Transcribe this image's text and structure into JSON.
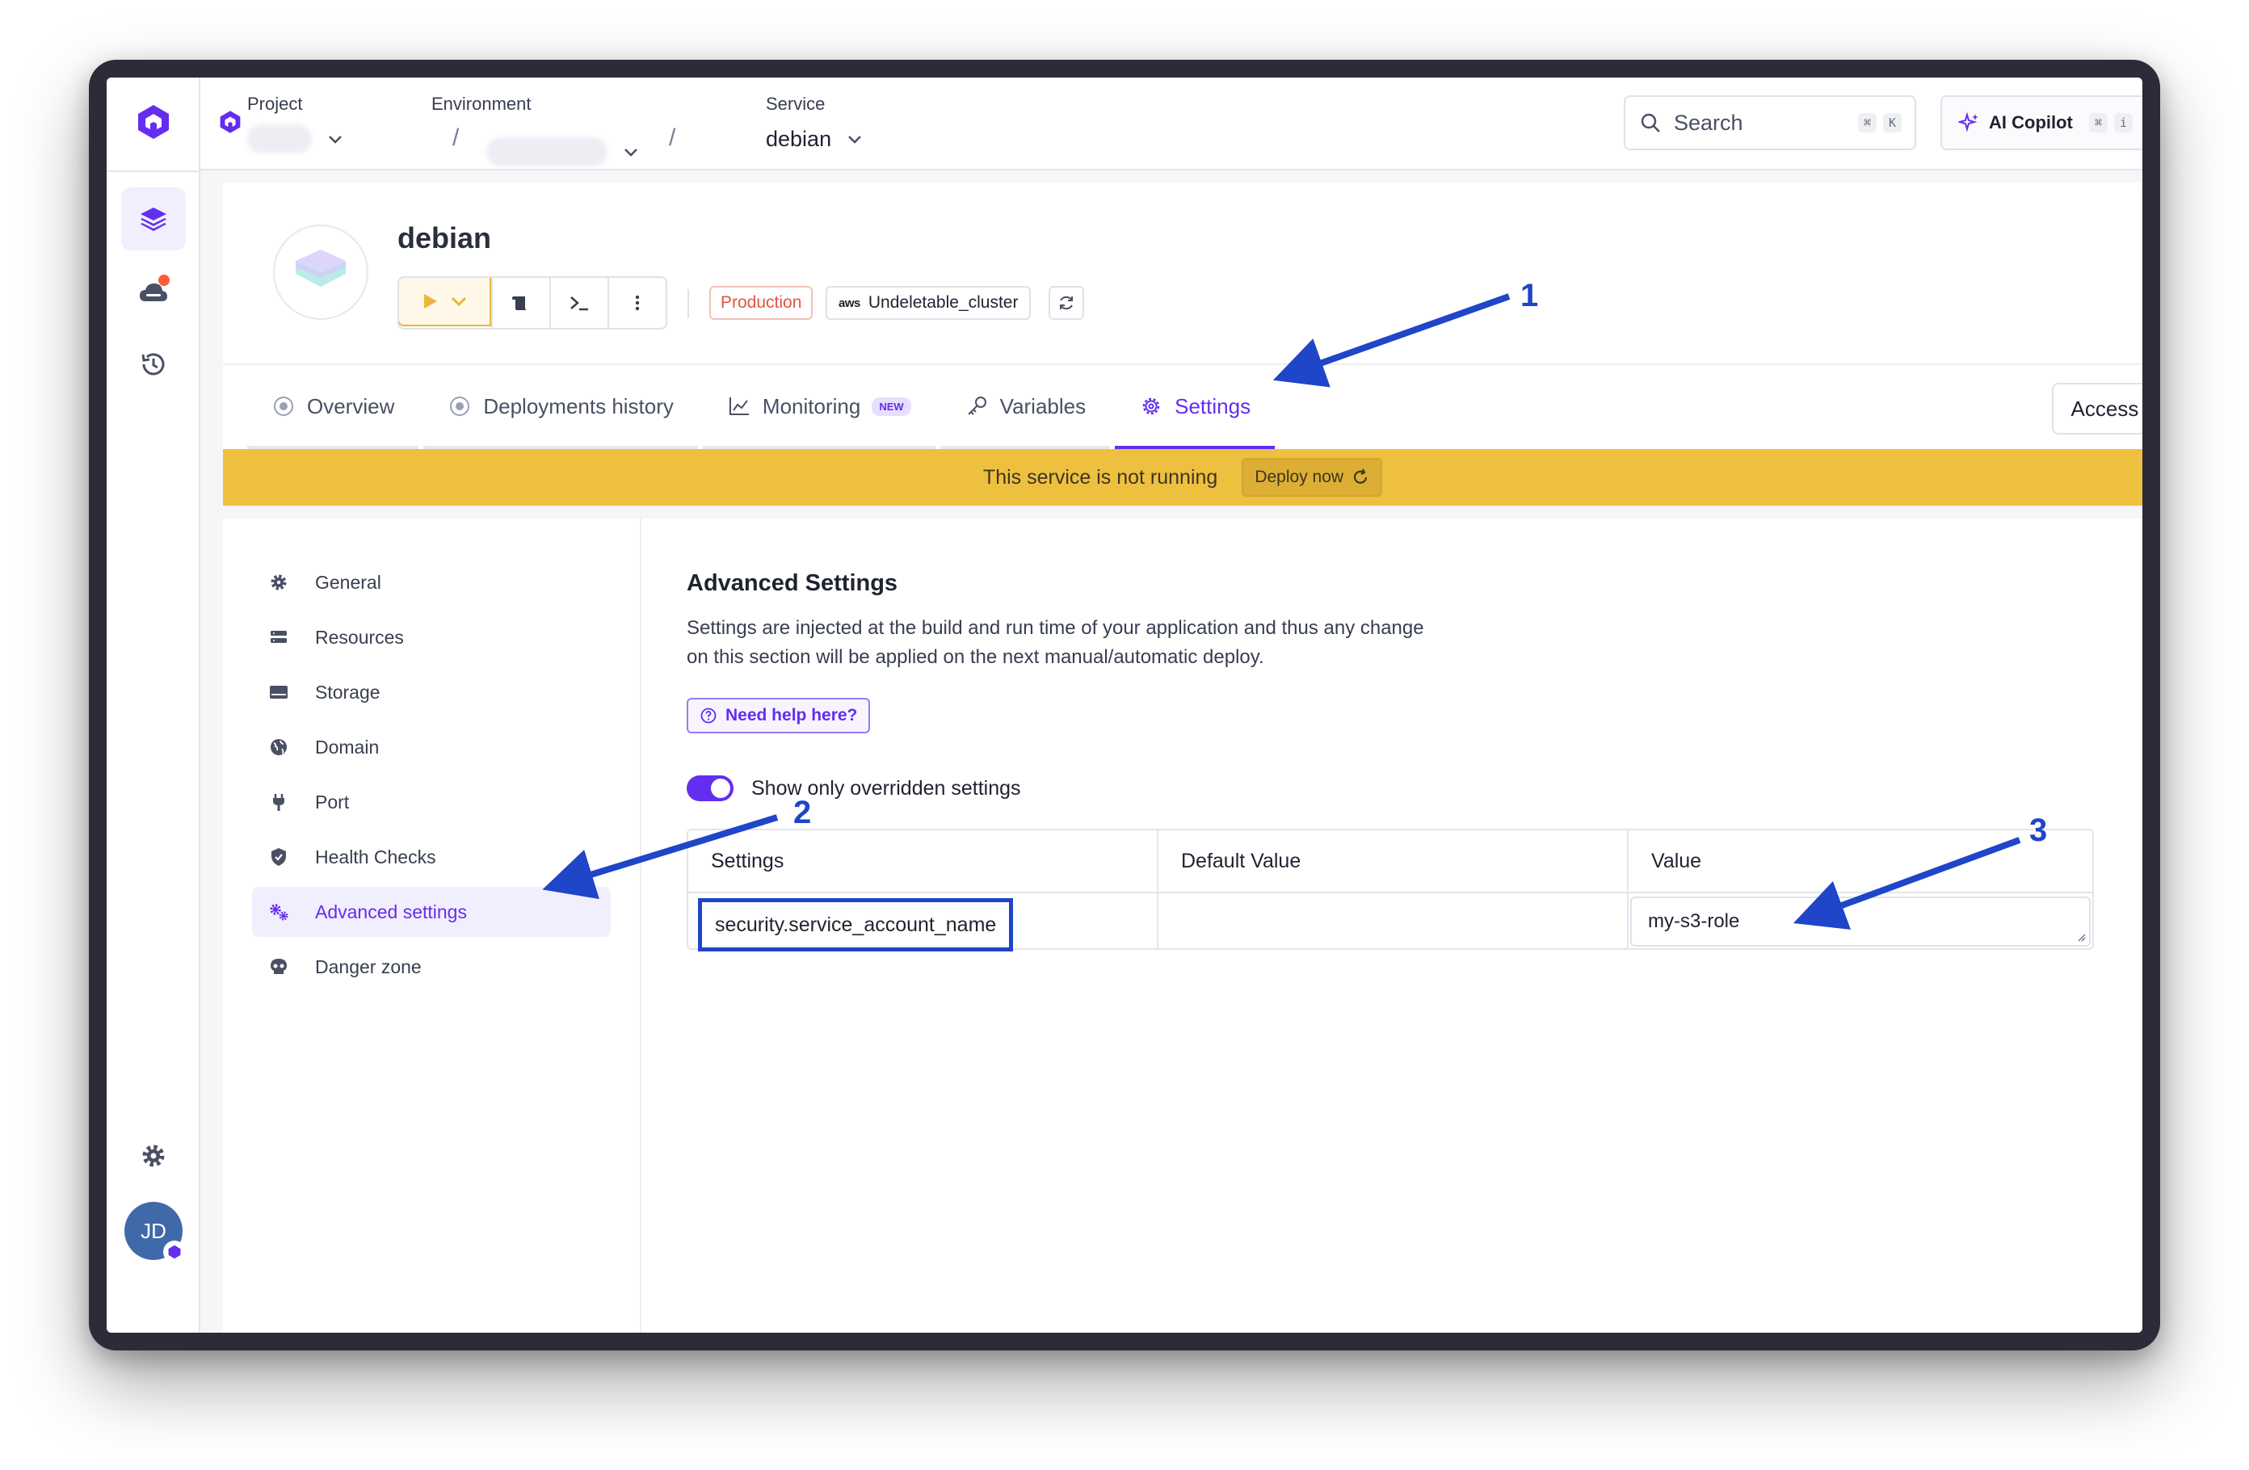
{
  "topbar": {
    "project_label": "Project",
    "environment_label": "Environment",
    "service_label": "Service",
    "service_value": "debian",
    "search_placeholder": "Search",
    "search_kbd_1": "⌘",
    "search_kbd_2": "K",
    "copilot_label": "AI Copilot",
    "copilot_kbd_1": "⌘",
    "copilot_kbd_2": "i"
  },
  "service": {
    "title": "debian",
    "env_tag": "Production",
    "cluster_provider": "aws",
    "cluster_name": "Undeletable_cluster"
  },
  "tabs": [
    {
      "label": "Overview",
      "icon": "circle-dot-icon"
    },
    {
      "label": "Deployments history",
      "icon": "circle-dot-icon"
    },
    {
      "label": "Monitoring",
      "icon": "chart-line-icon",
      "badge": "NEW"
    },
    {
      "label": "Variables",
      "icon": "key-icon"
    },
    {
      "label": "Settings",
      "icon": "gear-icon",
      "active": true
    }
  ],
  "access_info_label": "Access info",
  "banner": {
    "message": "This service is not running",
    "action_label": "Deploy now"
  },
  "settings_nav": [
    {
      "label": "General",
      "icon": "gear-icon"
    },
    {
      "label": "Resources",
      "icon": "server-icon"
    },
    {
      "label": "Storage",
      "icon": "hard-drive-icon"
    },
    {
      "label": "Domain",
      "icon": "globe-icon"
    },
    {
      "label": "Port",
      "icon": "plug-icon"
    },
    {
      "label": "Health Checks",
      "icon": "shield-check-icon"
    },
    {
      "label": "Advanced settings",
      "icon": "gears-icon",
      "active": true
    },
    {
      "label": "Danger zone",
      "icon": "skull-icon"
    }
  ],
  "advanced": {
    "title": "Advanced Settings",
    "description": "Settings are injected at the build and run time of your application and thus any change on this section will be applied on the next manual/automatic deploy.",
    "help_label": "Need help here?",
    "toggle_label": "Show only overridden settings",
    "toggle_on": true,
    "table": {
      "headers": [
        "Settings",
        "Default Value",
        "Value"
      ],
      "rows": [
        {
          "key": "security.service_account_name",
          "default": "",
          "value": "my-s3-role"
        }
      ]
    }
  },
  "user_initials": "JD",
  "fab_label": "?",
  "annotations": [
    "1",
    "2",
    "3"
  ],
  "colors": {
    "accent": "#642df0",
    "banner": "#eec03f",
    "annotation": "#1f45c8",
    "production": "#e0553d"
  }
}
